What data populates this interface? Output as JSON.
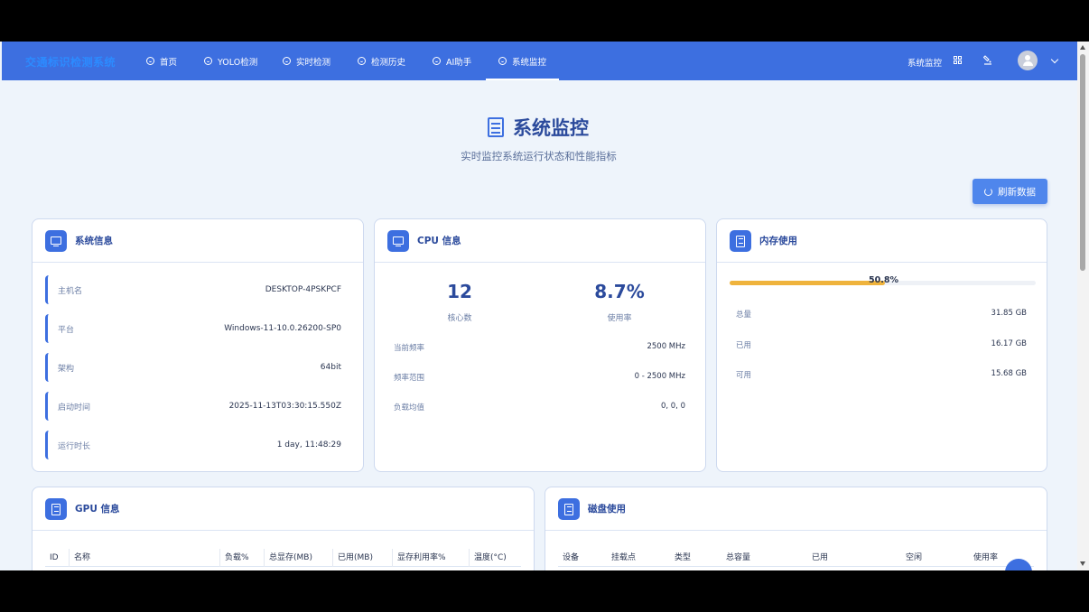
{
  "app": {
    "brand": "交通标识检测系统"
  },
  "nav": {
    "items": [
      {
        "label": "首页"
      },
      {
        "label": "YOLO检测"
      },
      {
        "label": "实时检测"
      },
      {
        "label": "检测历史"
      },
      {
        "label": "AI助手"
      },
      {
        "label": "系统监控"
      }
    ],
    "active": "系统监控",
    "right_label": "系统监控"
  },
  "page": {
    "title": "系统监控",
    "subtitle": "实时监控系统运行状态和性能指标",
    "refresh_label": "刷新数据"
  },
  "system": {
    "title": "系统信息",
    "rows": [
      {
        "k": "主机名",
        "v": "DESKTOP-4PSKPCF"
      },
      {
        "k": "平台",
        "v": "Windows-11-10.0.26200-SP0"
      },
      {
        "k": "架构",
        "v": "64bit"
      },
      {
        "k": "启动时间",
        "v": "2025-11-13T03:30:15.550Z"
      },
      {
        "k": "运行时长",
        "v": "1 day, 11:48:29"
      }
    ]
  },
  "cpu": {
    "title": "CPU 信息",
    "cores": "12",
    "cores_label": "核心数",
    "usage": "8.7%",
    "usage_label": "使用率",
    "rows": [
      {
        "k": "当前频率",
        "v": "2500 MHz"
      },
      {
        "k": "频率范围",
        "v": "0 - 2500 MHz"
      },
      {
        "k": "负载均值",
        "v": "0, 0, 0"
      }
    ]
  },
  "memory": {
    "title": "内存使用",
    "percent": "50.8%",
    "percent_value": 50.8,
    "bar_color": "#efb33c",
    "rows": [
      {
        "k": "总量",
        "v": "31.85 GB"
      },
      {
        "k": "已用",
        "v": "16.17 GB"
      },
      {
        "k": "可用",
        "v": "15.68 GB"
      }
    ]
  },
  "gpu": {
    "title": "GPU 信息",
    "columns": [
      "ID",
      "名称",
      "负载%",
      "总显存(MB)",
      "已用(MB)",
      "显存利用率%",
      "温度(°C)"
    ]
  },
  "disk": {
    "title": "磁盘使用",
    "columns": [
      "设备",
      "挂载点",
      "类型",
      "总容量",
      "已用",
      "空闲",
      "使用率"
    ]
  }
}
